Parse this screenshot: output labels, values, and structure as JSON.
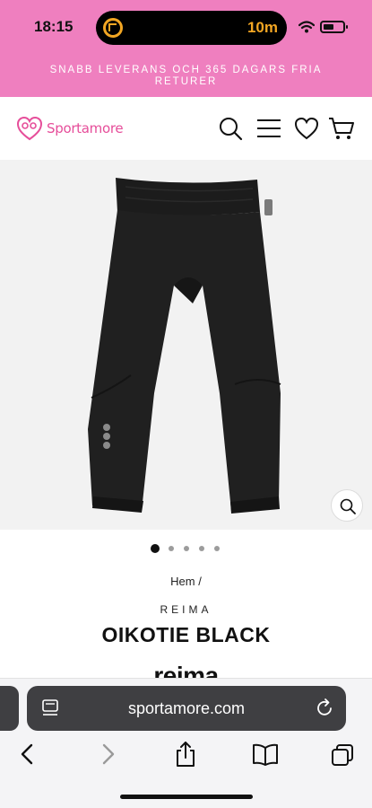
{
  "status_bar": {
    "time": "18:15",
    "activity_timer": "10m",
    "icons": [
      "timer-icon",
      "wifi-icon",
      "battery-icon"
    ]
  },
  "promo": {
    "text": "SNABB LEVERANS OCH 365 DAGARS FRIA RETURER"
  },
  "header": {
    "logo_text": "Sportamore",
    "icons": [
      "search-icon",
      "menu-icon",
      "heart-icon",
      "cart-icon"
    ]
  },
  "gallery": {
    "image_count": 5,
    "active_index": 0,
    "icons": [
      "zoom-icon"
    ]
  },
  "product": {
    "breadcrumb": "Hem /",
    "brand": "REIMA",
    "title": "OIKOTIE BLACK",
    "brand_logo_text": "reima"
  },
  "browser": {
    "url": "sportamore.com",
    "icons": [
      "page-menu-icon",
      "reload-icon",
      "back-icon",
      "forward-icon",
      "share-icon",
      "bookmarks-icon",
      "tabs-icon"
    ]
  },
  "colors": {
    "promo_bg": "#ef7fbf",
    "brand_pink": "#e64e9a",
    "timer_orange": "#f2a623",
    "url_bar_bg": "#3f3f42"
  }
}
